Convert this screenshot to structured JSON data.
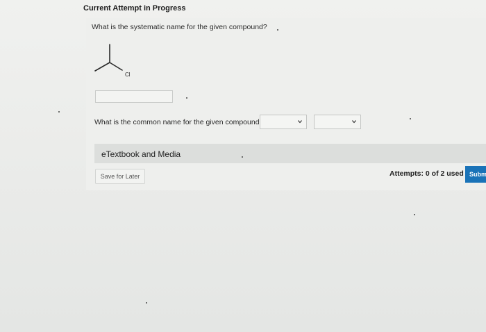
{
  "header": {
    "title": "Current Attempt in Progress"
  },
  "question1": {
    "prompt": "What is the systematic name for the given compound?",
    "molecule_label": "Cl",
    "answer_value": ""
  },
  "question2": {
    "prompt": "What is the common name for the given compound?",
    "select1_value": "",
    "select2_value": ""
  },
  "etextbook": {
    "label": "eTextbook and Media"
  },
  "footer": {
    "save_label": "Save for Later",
    "attempts_text": "Attempts: 0 of 2 used",
    "submit_label": "Subm"
  },
  "colors": {
    "submit_bg": "#1a73b8",
    "page_bg": "#e6e8e6"
  },
  "icons": [
    "chevron-down-icon"
  ]
}
